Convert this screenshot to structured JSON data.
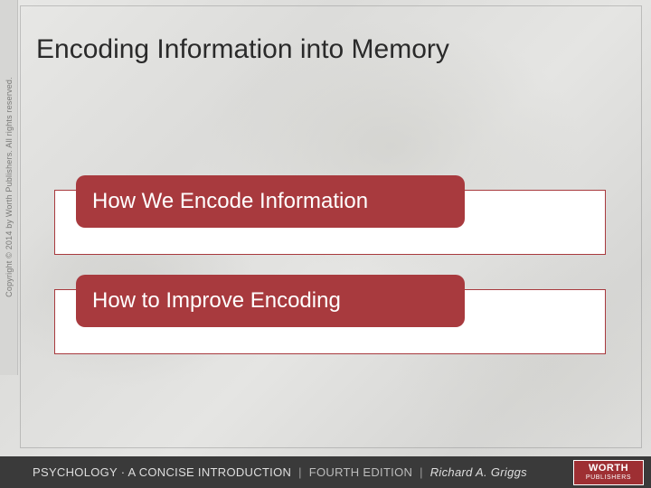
{
  "title": "Encoding Information into Memory",
  "topics": [
    {
      "label": "How We Encode Information"
    },
    {
      "label": "How to Improve Encoding"
    }
  ],
  "copyright": "Copyright © 2014 by Worth Publishers. All rights reserved.",
  "footer": {
    "book_title": "PSYCHOLOGY · A CONCISE INTRODUCTION",
    "edition": "FOURTH EDITION",
    "author": "Richard A. Griggs",
    "publisher_line1": "WORTH",
    "publisher_line2": "PUBLISHERS"
  }
}
